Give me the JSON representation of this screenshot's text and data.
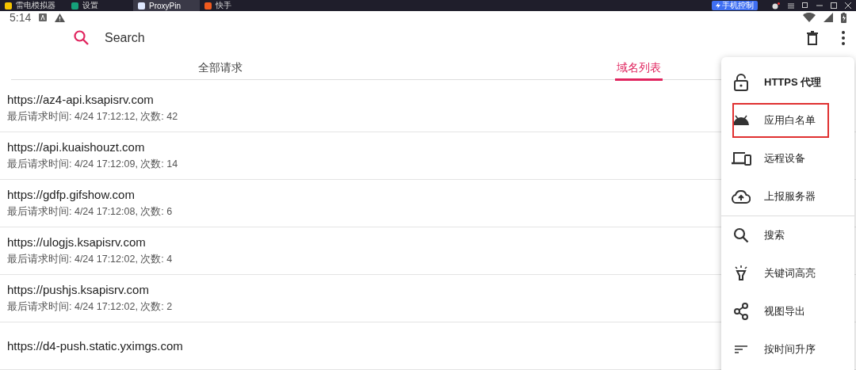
{
  "emulator_bar": {
    "tabs": [
      {
        "label": "雷电模拟器",
        "selected": false
      },
      {
        "label": "设置",
        "selected": false
      },
      {
        "label": "ProxyPin",
        "selected": true
      },
      {
        "label": "快手",
        "selected": false
      }
    ],
    "phone_control_button": "手机控制"
  },
  "status_bar": {
    "time": "5:14"
  },
  "app_bar": {
    "search": {
      "placeholder": "Search"
    }
  },
  "tabs": [
    {
      "label": "全部请求",
      "selected": false
    },
    {
      "label": "域名列表",
      "selected": true
    }
  ],
  "domains": [
    {
      "host": "https://az4-api.ksapisrv.com",
      "detail": "最后请求时间: 4/24 17:12:12,  次数: 42"
    },
    {
      "host": "https://api.kuaishouzt.com",
      "detail": "最后请求时间: 4/24 17:12:09,  次数: 14"
    },
    {
      "host": "https://gdfp.gifshow.com",
      "detail": "最后请求时间: 4/24 17:12:08,  次数: 6"
    },
    {
      "host": "https://ulogjs.ksapisrv.com",
      "detail": "最后请求时间: 4/24 17:12:02,  次数: 4"
    },
    {
      "host": "https://pushjs.ksapisrv.com",
      "detail": "最后请求时间: 4/24 17:12:02,  次数: 2"
    },
    {
      "host": "https://d4-push.static.yximgs.com"
    }
  ],
  "menu": {
    "groups": [
      [
        {
          "kind": "lock",
          "label": "HTTPS 代理",
          "highlighted": false
        },
        {
          "kind": "android",
          "label": "应用白名单",
          "highlighted": true
        },
        {
          "kind": "devices",
          "label": "远程设备",
          "highlighted": false
        },
        {
          "kind": "cloud",
          "label": "上报服务器",
          "highlighted": false
        }
      ],
      [
        {
          "kind": "search",
          "label": "搜索",
          "highlighted": false
        },
        {
          "kind": "bulb",
          "label": "关键词高亮",
          "highlighted": false
        },
        {
          "kind": "share",
          "label": "视图导出",
          "highlighted": false
        },
        {
          "kind": "sort",
          "label": "按时间升序",
          "highlighted": false
        }
      ]
    ]
  }
}
